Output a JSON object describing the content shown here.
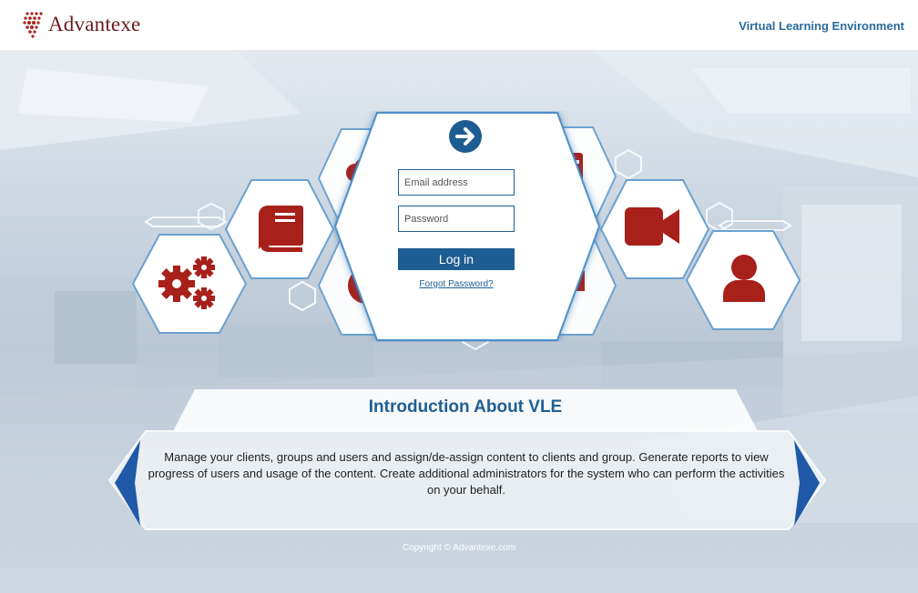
{
  "header": {
    "logo_text": "Advantexe",
    "app_title": "Virtual Learning Environment"
  },
  "colors": {
    "brand_red": "#a8201a",
    "brand_blue": "#1d5d92",
    "title_blue": "#2a6a9c"
  },
  "hex_icons": [
    "gears-icon",
    "book-icon",
    "cloud-icon",
    "globe-icon",
    "calendar-icon",
    "presentation-icon",
    "video-camera-icon",
    "user-icon"
  ],
  "login": {
    "email_placeholder": "Email address",
    "password_placeholder": "Password",
    "submit_label": "Log in",
    "forgot_password": "Forgot Password?",
    "proceed_icon": "arrow-right-icon"
  },
  "intro": {
    "title": "Introduction About VLE",
    "body": "Manage your clients, groups and users and assign/de-assign content to clients and group. Generate reports to view progress of users and usage of the content. Create additional administrators for the system who can perform the activities on your behalf.",
    "prev_icon": "chevron-left-icon",
    "next_icon": "chevron-right-icon"
  },
  "footer": {
    "copyright": "Copyright © Advantexe.com"
  }
}
